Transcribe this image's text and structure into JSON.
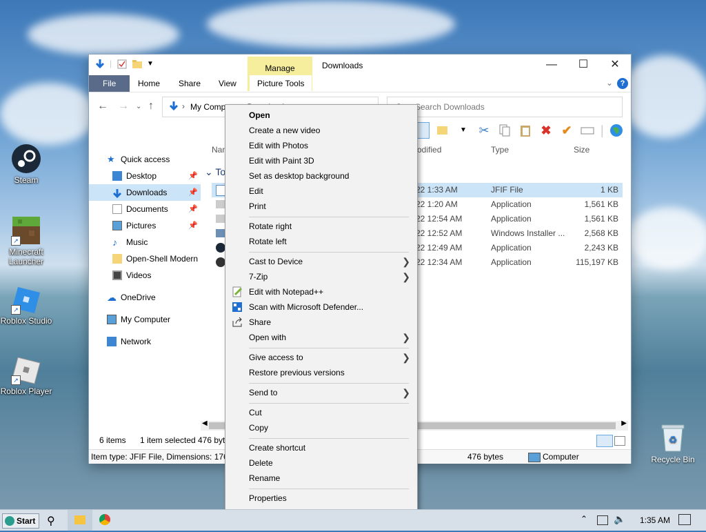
{
  "desktop": {
    "icons": [
      {
        "label": "Steam"
      },
      {
        "label": "Minecraft Launcher"
      },
      {
        "label": "Roblox Studio"
      },
      {
        "label": "Roblox Player"
      }
    ],
    "recycle_bin": "Recycle Bin"
  },
  "window": {
    "title": "Downloads",
    "manage_tab": "Manage",
    "ribbon_tabs": [
      "File",
      "Home",
      "Share",
      "View",
      "Picture Tools"
    ],
    "address": "My Computer › Downloads",
    "search_placeholder": "Search Downloads"
  },
  "nav": {
    "items": [
      {
        "label": "Quick access"
      },
      {
        "label": "Desktop"
      },
      {
        "label": "Downloads"
      },
      {
        "label": "Documents"
      },
      {
        "label": "Pictures"
      },
      {
        "label": "Music"
      },
      {
        "label": "Open-Shell Modern"
      },
      {
        "label": "Videos"
      },
      {
        "label": "OneDrive"
      },
      {
        "label": "My Computer"
      },
      {
        "label": "Network"
      }
    ]
  },
  "files": {
    "columns": {
      "name": "Nam",
      "modified": "odified",
      "type": "Type",
      "size": "Size"
    },
    "group": "To",
    "rows": [
      {
        "date": "22 1:33 AM",
        "type": "JFIF File",
        "size": "1 KB"
      },
      {
        "date": "22 1:20 AM",
        "type": "Application",
        "size": "1,561 KB"
      },
      {
        "date": "22 12:54 AM",
        "type": "Application",
        "size": "1,561 KB"
      },
      {
        "date": "22 12:52 AM",
        "type": "Windows Installer ...",
        "size": "2,568 KB"
      },
      {
        "date": "22 12:49 AM",
        "type": "Application",
        "size": "2,243 KB"
      },
      {
        "date": "22 12:34 AM",
        "type": "Application",
        "size": "115,197 KB"
      }
    ]
  },
  "status": {
    "count": "6 items",
    "selected": "1 item selected",
    "size_trunc": "476 byt",
    "info": "Item type: JFIF File, Dimensions: 176 x",
    "bytes": "476 bytes",
    "location": "Computer"
  },
  "context_menu": {
    "groups": [
      [
        "Open",
        "Create a new video",
        "Edit with Photos",
        "Edit with Paint 3D",
        "Set as desktop background",
        "Edit",
        "Print"
      ],
      [
        "Rotate right",
        "Rotate left"
      ],
      [
        "Cast to Device",
        "7-Zip",
        "Edit with Notepad++",
        "Scan with Microsoft Defender...",
        "Share",
        "Open with"
      ],
      [
        "Give access to",
        "Restore previous versions"
      ],
      [
        "Send to"
      ],
      [
        "Cut",
        "Copy"
      ],
      [
        "Create shortcut",
        "Delete",
        "Rename"
      ],
      [
        "Properties"
      ]
    ]
  },
  "taskbar": {
    "start": "Start",
    "time": "1:35 AM"
  }
}
